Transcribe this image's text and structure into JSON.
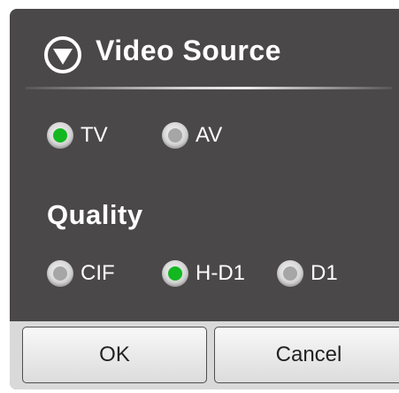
{
  "dialog": {
    "title": "Video Source",
    "title_icon": "circle-down-triangle-icon",
    "source": {
      "options": [
        {
          "label": "TV",
          "selected": true
        },
        {
          "label": "AV",
          "selected": false
        }
      ]
    },
    "quality": {
      "heading": "Quality",
      "options": [
        {
          "label": "CIF",
          "selected": false
        },
        {
          "label": "H-D1",
          "selected": true
        },
        {
          "label": "D1",
          "selected": false
        }
      ]
    },
    "buttons": {
      "ok": "OK",
      "cancel": "Cancel"
    }
  },
  "colors": {
    "panel": "#4a4848",
    "selected": "#13b821",
    "unselected": "#a6a6a6",
    "text": "#ffffff"
  }
}
